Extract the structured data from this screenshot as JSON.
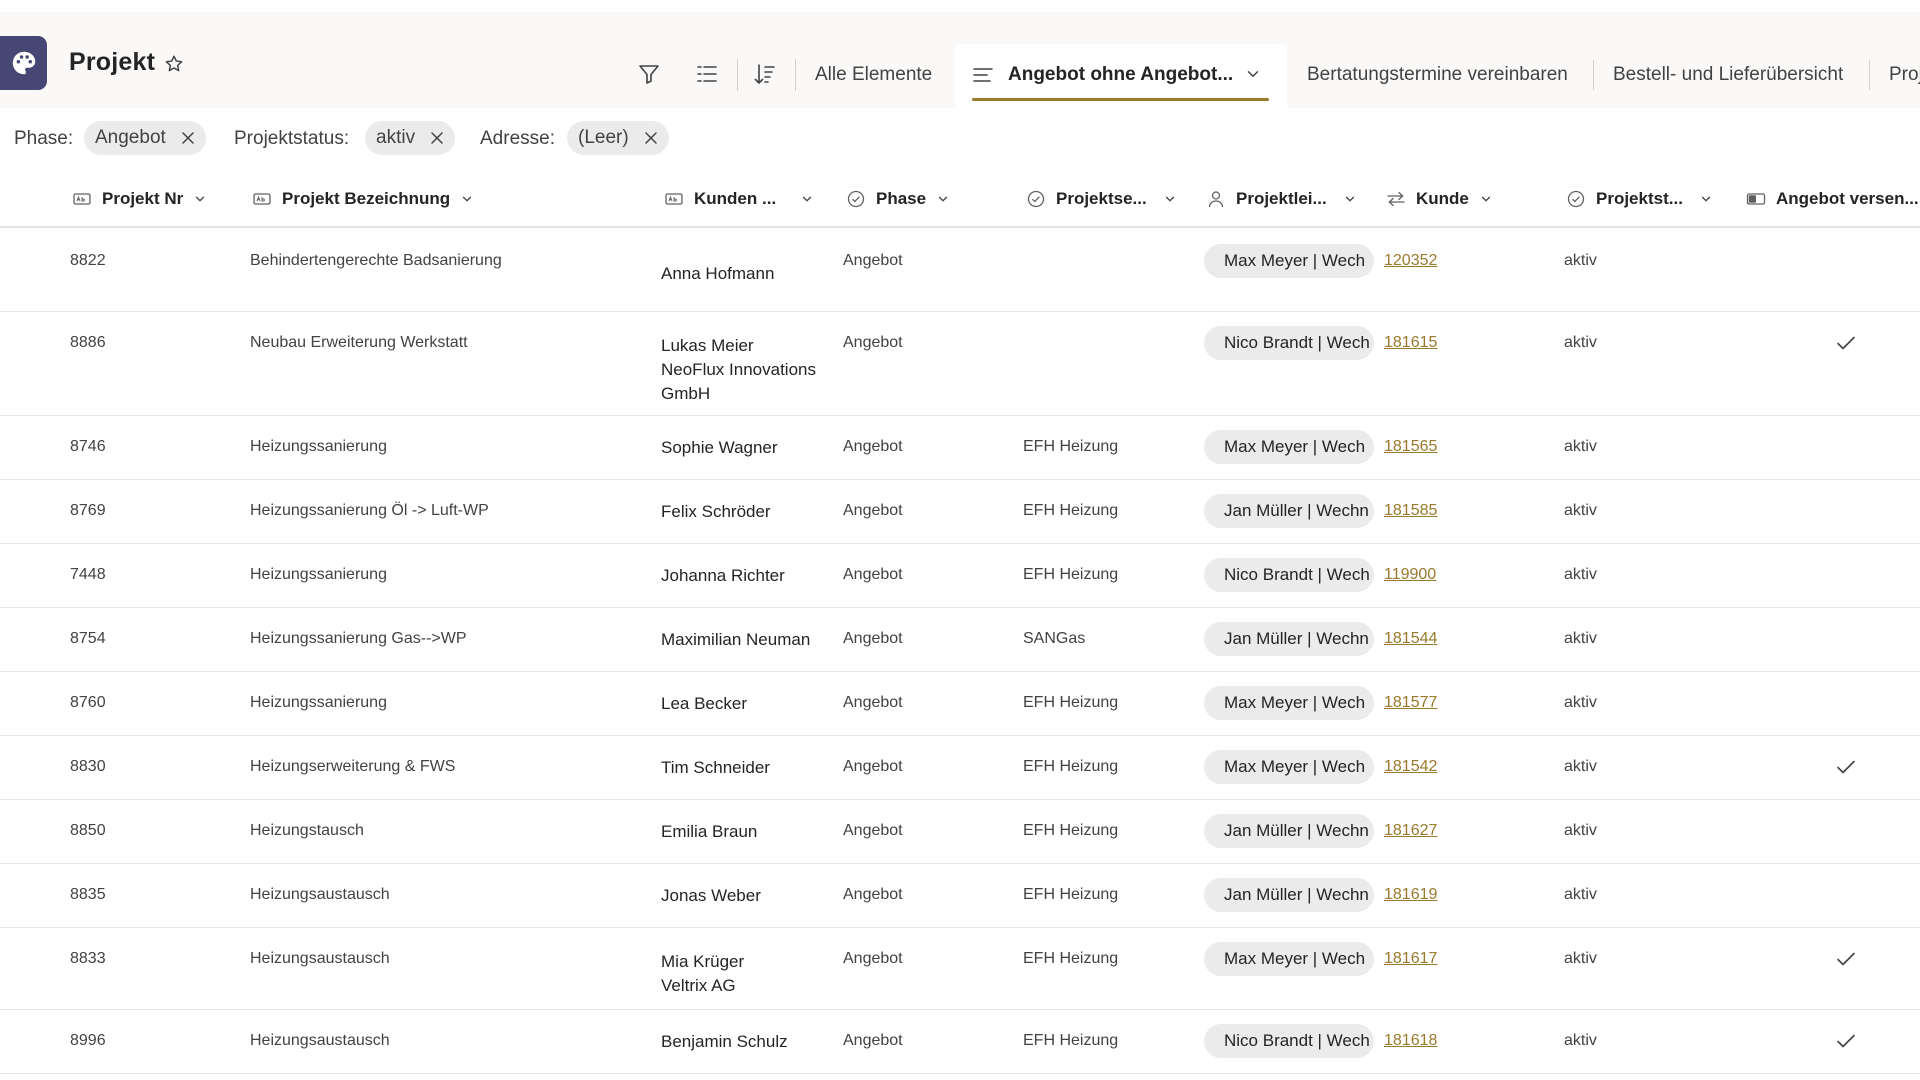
{
  "header": {
    "title": "Projekt",
    "views": {
      "all": "Alle Elemente",
      "active": "Angebot ohne Angebot...",
      "v3": "Bertatungstermine vereinbaren",
      "v4": "Bestell- und Lieferübersicht",
      "v5": "Proj"
    }
  },
  "filters": [
    {
      "label": "Phase:",
      "value": "Angebot"
    },
    {
      "label": "Projektstatus:",
      "value": "aktiv"
    },
    {
      "label": "Adresse:",
      "value": "(Leer)"
    }
  ],
  "columns": [
    "Projekt Nr",
    "Projekt Bezeichnung",
    "Kunden ...",
    "Phase",
    "Projektse...",
    "Projektlei...",
    "Kunde",
    "Projektst...",
    "Angebot versen..."
  ],
  "rows": [
    {
      "nr": "8822",
      "bez": "Behindertengerechte Badsanierung",
      "kunde1": "Anna Hofmann",
      "kunde2": "",
      "phase": "Angebot",
      "typ": "",
      "leiter": "Max Meyer | Wech",
      "ref": "120352",
      "status": "aktiv",
      "sent": false
    },
    {
      "nr": "8886",
      "bez": "Neubau Erweiterung Werkstatt",
      "kunde1": "Lukas Meier",
      "kunde2": "NeoFlux Innovations GmbH",
      "phase": "Angebot",
      "typ": "",
      "leiter": "Nico Brandt | Wech",
      "ref": "181615",
      "status": "aktiv",
      "sent": true
    },
    {
      "nr": "8746",
      "bez": "Heizungssanierung",
      "kunde1": "Sophie Wagner",
      "kunde2": "",
      "phase": "Angebot",
      "typ": "EFH Heizung",
      "leiter": "Max Meyer | Wech",
      "ref": "181565",
      "status": "aktiv",
      "sent": false
    },
    {
      "nr": "8769",
      "bez": "Heizungssanierung Öl -> Luft-WP",
      "kunde1": "Felix Schröder",
      "kunde2": "",
      "phase": "Angebot",
      "typ": "EFH Heizung",
      "leiter": "Jan Müller | Wechn",
      "ref": "181585",
      "status": "aktiv",
      "sent": false
    },
    {
      "nr": "7448",
      "bez": "Heizungssanierung",
      "kunde1": "Johanna Richter",
      "kunde2": "",
      "phase": "Angebot",
      "typ": "EFH Heizung",
      "leiter": "Nico Brandt | Wech",
      "ref": "119900",
      "status": "aktiv",
      "sent": false
    },
    {
      "nr": "8754",
      "bez": "Heizungssanierung Gas-->WP",
      "kunde1": "Maximilian Neuman",
      "kunde2": "",
      "phase": "Angebot",
      "typ": "SANGas",
      "leiter": "Jan Müller | Wechn",
      "ref": "181544",
      "status": "aktiv",
      "sent": false
    },
    {
      "nr": "8760",
      "bez": "Heizungssanierung",
      "kunde1": "Lea Becker",
      "kunde2": "",
      "phase": "Angebot",
      "typ": "EFH Heizung",
      "leiter": "Max Meyer | Wech",
      "ref": "181577",
      "status": "aktiv",
      "sent": false
    },
    {
      "nr": "8830",
      "bez": "Heizungserweiterung & FWS",
      "kunde1": "Tim Schneider",
      "kunde2": "",
      "phase": "Angebot",
      "typ": "EFH Heizung",
      "leiter": "Max Meyer | Wech",
      "ref": "181542",
      "status": "aktiv",
      "sent": true
    },
    {
      "nr": "8850",
      "bez": "Heizungstausch",
      "kunde1": "Emilia Braun",
      "kunde2": "",
      "phase": "Angebot",
      "typ": "EFH Heizung",
      "leiter": "Jan Müller | Wechn",
      "ref": "181627",
      "status": "aktiv",
      "sent": false
    },
    {
      "nr": "8835",
      "bez": "Heizungsaustausch",
      "kunde1": "Jonas Weber",
      "kunde2": "",
      "phase": "Angebot",
      "typ": "EFH Heizung",
      "leiter": "Jan Müller | Wechn",
      "ref": "181619",
      "status": "aktiv",
      "sent": false
    },
    {
      "nr": "8833",
      "bez": "Heizungsaustausch",
      "kunde1": "Mia Krüger",
      "kunde2": "Veltrix AG",
      "phase": "Angebot",
      "typ": "EFH Heizung",
      "leiter": "Max Meyer | Wech",
      "ref": "181617",
      "status": "aktiv",
      "sent": true
    },
    {
      "nr": "8996",
      "bez": "Heizungsaustausch",
      "kunde1": "Benjamin Schulz",
      "kunde2": "",
      "phase": "Angebot",
      "typ": "EFH Heizung",
      "leiter": "Nico Brandt | Wech",
      "ref": "181618",
      "status": "aktiv",
      "sent": true
    }
  ]
}
